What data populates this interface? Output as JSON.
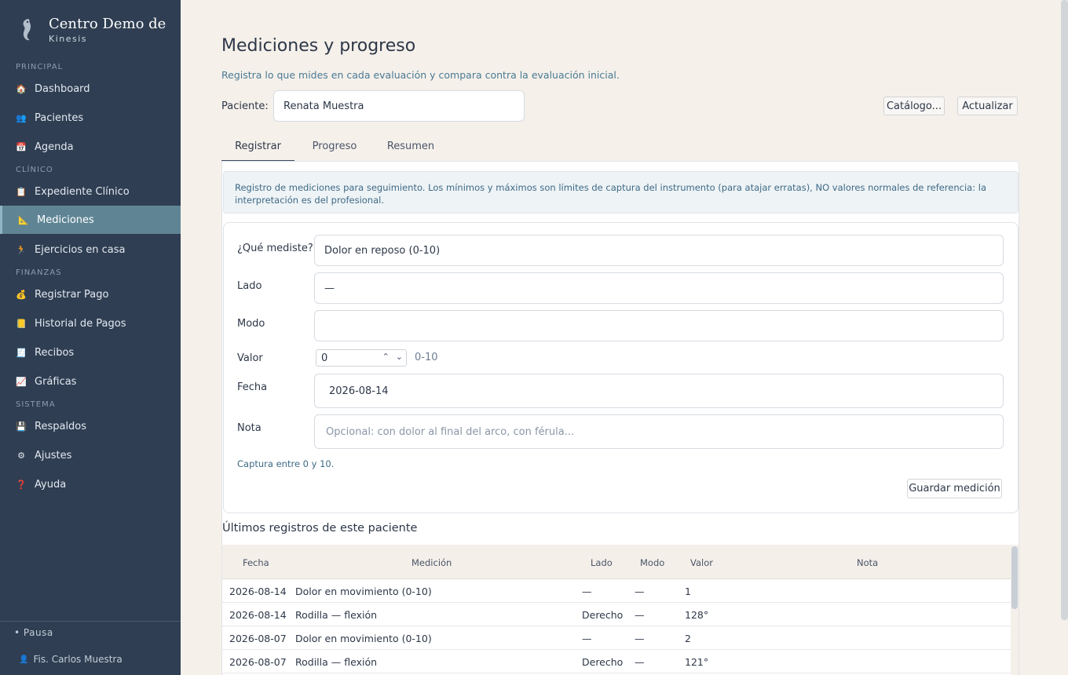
{
  "brand": {
    "title": "Centro Demo de Rehabilitación",
    "subtitle": "Kinesis"
  },
  "sidebar": {
    "sections": {
      "principal": "PRINCIPAL",
      "clinico": "CLÍNICO",
      "finanzas": "FINANZAS",
      "sistema": "SISTEMA"
    },
    "items": [
      {
        "label": "Dashboard",
        "icon": "house-icon",
        "glyph": "🏠"
      },
      {
        "label": "Pacientes",
        "icon": "people-icon",
        "glyph": "👥"
      },
      {
        "label": "Agenda",
        "icon": "calendar-icon",
        "glyph": "📅"
      },
      {
        "label": "Expediente Clínico",
        "icon": "clipboard-icon",
        "glyph": "📋"
      },
      {
        "label": "Mediciones",
        "icon": "ruler-icon",
        "glyph": "📐"
      },
      {
        "label": "Ejercicios en casa",
        "icon": "running-icon",
        "glyph": "🏃"
      },
      {
        "label": "Registrar Pago",
        "icon": "money-bag-icon",
        "glyph": "💰"
      },
      {
        "label": "Historial de Pagos",
        "icon": "ledger-icon",
        "glyph": "📒"
      },
      {
        "label": "Recibos",
        "icon": "receipt-icon",
        "glyph": "🧾"
      },
      {
        "label": "Gráficas",
        "icon": "chart-icon",
        "glyph": "📈"
      },
      {
        "label": "Respaldos",
        "icon": "floppy-icon",
        "glyph": "💾"
      },
      {
        "label": "Ajustes",
        "icon": "gear-icon",
        "glyph": "⚙"
      },
      {
        "label": "Ayuda",
        "icon": "question-icon",
        "glyph": "❓"
      }
    ],
    "pause_label": "Pausa",
    "user_label": "Fis. Carlos Muestra"
  },
  "header": {
    "title": "Mediciones y progreso",
    "subtitle": "Registra lo que mides en cada evaluación y compara contra la evaluación inicial.",
    "patient_label": "Paciente:",
    "patient_value": "Renata Muestra",
    "catalog_button": "Catálogo...",
    "refresh_button": "Actualizar"
  },
  "tabs": [
    {
      "label": "Registrar"
    },
    {
      "label": "Progreso"
    },
    {
      "label": "Resumen"
    }
  ],
  "info_text": "Registro de mediciones para seguimiento. Los mínimos y máximos son límites de captura del instrumento (para atajar erratas), NO valores normales de referencia: la interpretación es del profesional.",
  "form": {
    "what_label": "¿Qué mediste?",
    "what_value": "Dolor en reposo (0-10)",
    "side_label": "Lado",
    "side_value": "—",
    "mode_label": "Modo",
    "mode_value": "",
    "value_label": "Valor",
    "value_value": "0",
    "value_range": "0-10",
    "date_label": "Fecha",
    "date_value": "2026-08-14",
    "note_label": "Nota",
    "note_placeholder": "Opcional: con dolor al final del arco, con férula...",
    "capture_hint": "Captura entre 0 y 10.",
    "save_button": "Guardar medición"
  },
  "recent": {
    "title": "Últimos registros de este paciente",
    "columns": {
      "fecha": "Fecha",
      "medicion": "Medición",
      "lado": "Lado",
      "modo": "Modo",
      "valor": "Valor",
      "nota": "Nota"
    },
    "rows": [
      {
        "fecha": "2026-08-14",
        "medicion": "Dolor en movimiento (0-10)",
        "lado": "—",
        "modo": "—",
        "valor": "1",
        "nota": ""
      },
      {
        "fecha": "2026-08-14",
        "medicion": "Rodilla — flexión",
        "lado": "Derecho",
        "modo": "—",
        "valor": "128°",
        "nota": ""
      },
      {
        "fecha": "2026-08-07",
        "medicion": "Dolor en movimiento (0-10)",
        "lado": "—",
        "modo": "—",
        "valor": "2",
        "nota": ""
      },
      {
        "fecha": "2026-08-07",
        "medicion": "Rodilla — flexión",
        "lado": "Derecho",
        "modo": "—",
        "valor": "121°",
        "nota": ""
      }
    ]
  }
}
